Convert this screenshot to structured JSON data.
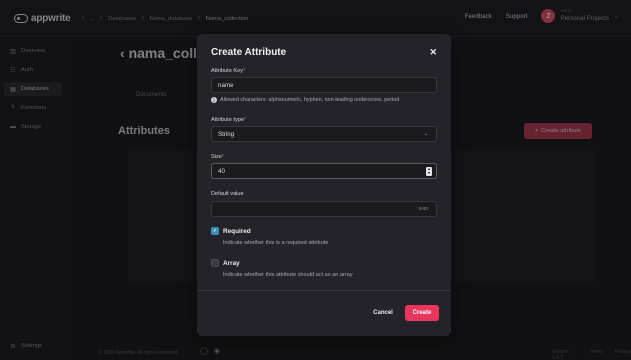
{
  "topbar": {
    "logo_text": "appwrite",
    "breadcrumbs": [
      "/",
      "...",
      "/",
      "Databases",
      "/",
      "Nama_database",
      "/",
      "Nama_collection"
    ],
    "feedback_label": "Feedback",
    "support_label": "Support",
    "avatar_initial": "Z",
    "org_sub": "Avon",
    "org_name": "Personal Projects",
    "chevron_icon": "chevron-down-icon"
  },
  "sidebar": {
    "items": [
      {
        "label": "Overview",
        "icon": "chart-icon",
        "glyph": "▥"
      },
      {
        "label": "Auth",
        "icon": "users-icon",
        "glyph": "☷"
      },
      {
        "label": "Databases",
        "icon": "database-icon",
        "glyph": "▤"
      },
      {
        "label": "Functions",
        "icon": "lightning-icon",
        "glyph": "ϟ"
      },
      {
        "label": "Storage",
        "icon": "folder-icon",
        "glyph": "▬"
      }
    ],
    "settings_label": "Settings",
    "settings_glyph": "⚙"
  },
  "page": {
    "back_glyph": "‹",
    "title": "nama_colle",
    "tab_documents": "Documents",
    "attributes_heading": "Attributes",
    "create_attribute_label": "Create attribute",
    "create_attribute_glyph": "+"
  },
  "footer": {
    "copyright": "© 2022 Appwrite. All rights reserved.",
    "github_glyph": "◯",
    "discord_glyph": "◉",
    "version": "Version 1.1.2",
    "terms": "Terms",
    "privacy": "Privacy"
  },
  "modal": {
    "title": "Create Attribute",
    "close_glyph": "✕",
    "key_label": "Attribute Key",
    "required_mark": "*",
    "key_value": "name",
    "key_hint": "Allowed characters: alphanumeric, hyphen, non-leading underscore, period",
    "type_label": "Attribute type",
    "type_value": "String",
    "size_label": "Size",
    "size_value": "40",
    "default_label": "Default value",
    "default_value": "",
    "default_counter": "0/40",
    "required_title": "Required",
    "required_desc": "Indicate whether this is a required attribute",
    "required_checked": true,
    "array_title": "Array",
    "array_desc": "Indicate whether this attribute should act as an array",
    "array_checked": false,
    "cancel_label": "Cancel",
    "create_label": "Create"
  },
  "colors": {
    "accent": "#e8365d",
    "checkbox": "#3a8fb7",
    "modal_bg": "#232329"
  }
}
